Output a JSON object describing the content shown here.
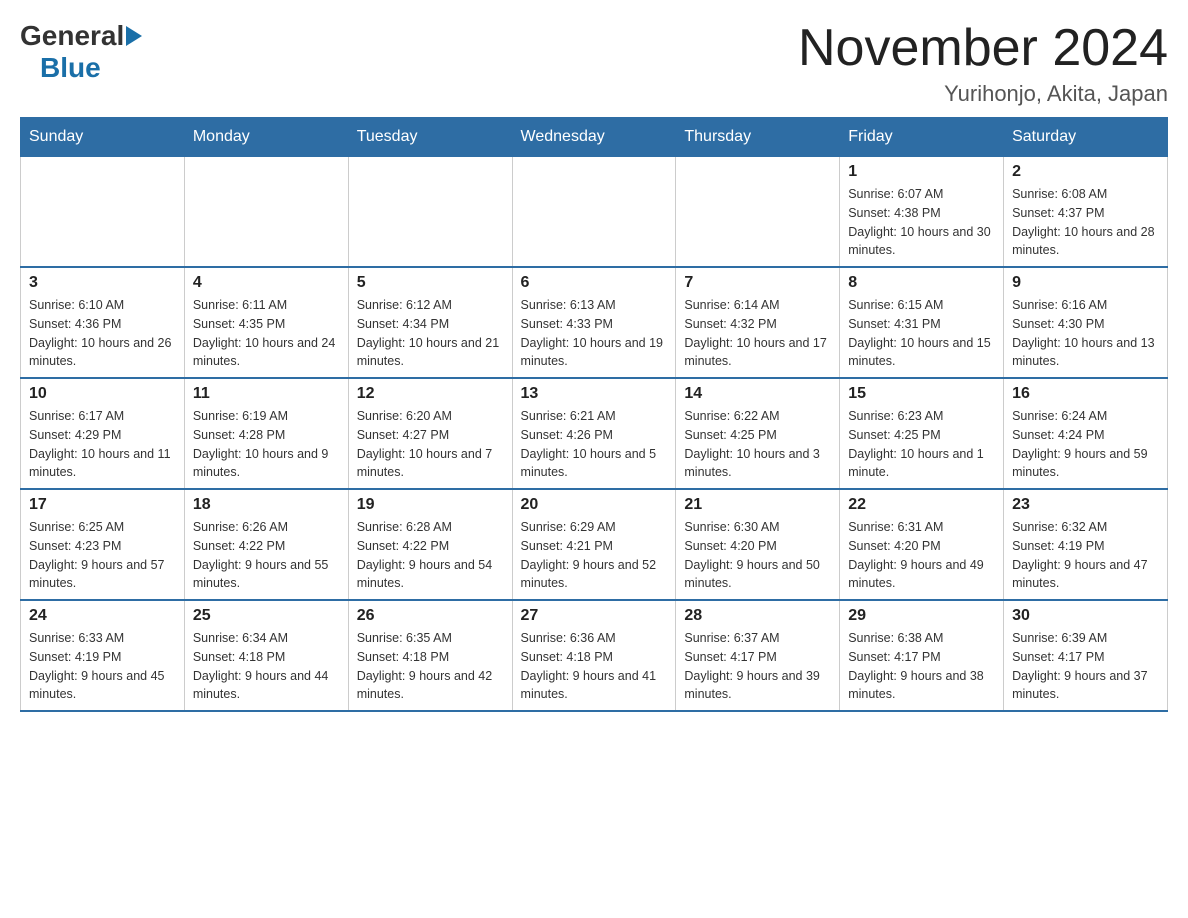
{
  "header": {
    "logo_general": "General",
    "logo_blue": "Blue",
    "title": "November 2024",
    "subtitle": "Yurihonjo, Akita, Japan"
  },
  "weekdays": [
    "Sunday",
    "Monday",
    "Tuesday",
    "Wednesday",
    "Thursday",
    "Friday",
    "Saturday"
  ],
  "weeks": [
    [
      {
        "day": "",
        "sunrise": "",
        "sunset": "",
        "daylight": ""
      },
      {
        "day": "",
        "sunrise": "",
        "sunset": "",
        "daylight": ""
      },
      {
        "day": "",
        "sunrise": "",
        "sunset": "",
        "daylight": ""
      },
      {
        "day": "",
        "sunrise": "",
        "sunset": "",
        "daylight": ""
      },
      {
        "day": "",
        "sunrise": "",
        "sunset": "",
        "daylight": ""
      },
      {
        "day": "1",
        "sunrise": "Sunrise: 6:07 AM",
        "sunset": "Sunset: 4:38 PM",
        "daylight": "Daylight: 10 hours and 30 minutes."
      },
      {
        "day": "2",
        "sunrise": "Sunrise: 6:08 AM",
        "sunset": "Sunset: 4:37 PM",
        "daylight": "Daylight: 10 hours and 28 minutes."
      }
    ],
    [
      {
        "day": "3",
        "sunrise": "Sunrise: 6:10 AM",
        "sunset": "Sunset: 4:36 PM",
        "daylight": "Daylight: 10 hours and 26 minutes."
      },
      {
        "day": "4",
        "sunrise": "Sunrise: 6:11 AM",
        "sunset": "Sunset: 4:35 PM",
        "daylight": "Daylight: 10 hours and 24 minutes."
      },
      {
        "day": "5",
        "sunrise": "Sunrise: 6:12 AM",
        "sunset": "Sunset: 4:34 PM",
        "daylight": "Daylight: 10 hours and 21 minutes."
      },
      {
        "day": "6",
        "sunrise": "Sunrise: 6:13 AM",
        "sunset": "Sunset: 4:33 PM",
        "daylight": "Daylight: 10 hours and 19 minutes."
      },
      {
        "day": "7",
        "sunrise": "Sunrise: 6:14 AM",
        "sunset": "Sunset: 4:32 PM",
        "daylight": "Daylight: 10 hours and 17 minutes."
      },
      {
        "day": "8",
        "sunrise": "Sunrise: 6:15 AM",
        "sunset": "Sunset: 4:31 PM",
        "daylight": "Daylight: 10 hours and 15 minutes."
      },
      {
        "day": "9",
        "sunrise": "Sunrise: 6:16 AM",
        "sunset": "Sunset: 4:30 PM",
        "daylight": "Daylight: 10 hours and 13 minutes."
      }
    ],
    [
      {
        "day": "10",
        "sunrise": "Sunrise: 6:17 AM",
        "sunset": "Sunset: 4:29 PM",
        "daylight": "Daylight: 10 hours and 11 minutes."
      },
      {
        "day": "11",
        "sunrise": "Sunrise: 6:19 AM",
        "sunset": "Sunset: 4:28 PM",
        "daylight": "Daylight: 10 hours and 9 minutes."
      },
      {
        "day": "12",
        "sunrise": "Sunrise: 6:20 AM",
        "sunset": "Sunset: 4:27 PM",
        "daylight": "Daylight: 10 hours and 7 minutes."
      },
      {
        "day": "13",
        "sunrise": "Sunrise: 6:21 AM",
        "sunset": "Sunset: 4:26 PM",
        "daylight": "Daylight: 10 hours and 5 minutes."
      },
      {
        "day": "14",
        "sunrise": "Sunrise: 6:22 AM",
        "sunset": "Sunset: 4:25 PM",
        "daylight": "Daylight: 10 hours and 3 minutes."
      },
      {
        "day": "15",
        "sunrise": "Sunrise: 6:23 AM",
        "sunset": "Sunset: 4:25 PM",
        "daylight": "Daylight: 10 hours and 1 minute."
      },
      {
        "day": "16",
        "sunrise": "Sunrise: 6:24 AM",
        "sunset": "Sunset: 4:24 PM",
        "daylight": "Daylight: 9 hours and 59 minutes."
      }
    ],
    [
      {
        "day": "17",
        "sunrise": "Sunrise: 6:25 AM",
        "sunset": "Sunset: 4:23 PM",
        "daylight": "Daylight: 9 hours and 57 minutes."
      },
      {
        "day": "18",
        "sunrise": "Sunrise: 6:26 AM",
        "sunset": "Sunset: 4:22 PM",
        "daylight": "Daylight: 9 hours and 55 minutes."
      },
      {
        "day": "19",
        "sunrise": "Sunrise: 6:28 AM",
        "sunset": "Sunset: 4:22 PM",
        "daylight": "Daylight: 9 hours and 54 minutes."
      },
      {
        "day": "20",
        "sunrise": "Sunrise: 6:29 AM",
        "sunset": "Sunset: 4:21 PM",
        "daylight": "Daylight: 9 hours and 52 minutes."
      },
      {
        "day": "21",
        "sunrise": "Sunrise: 6:30 AM",
        "sunset": "Sunset: 4:20 PM",
        "daylight": "Daylight: 9 hours and 50 minutes."
      },
      {
        "day": "22",
        "sunrise": "Sunrise: 6:31 AM",
        "sunset": "Sunset: 4:20 PM",
        "daylight": "Daylight: 9 hours and 49 minutes."
      },
      {
        "day": "23",
        "sunrise": "Sunrise: 6:32 AM",
        "sunset": "Sunset: 4:19 PM",
        "daylight": "Daylight: 9 hours and 47 minutes."
      }
    ],
    [
      {
        "day": "24",
        "sunrise": "Sunrise: 6:33 AM",
        "sunset": "Sunset: 4:19 PM",
        "daylight": "Daylight: 9 hours and 45 minutes."
      },
      {
        "day": "25",
        "sunrise": "Sunrise: 6:34 AM",
        "sunset": "Sunset: 4:18 PM",
        "daylight": "Daylight: 9 hours and 44 minutes."
      },
      {
        "day": "26",
        "sunrise": "Sunrise: 6:35 AM",
        "sunset": "Sunset: 4:18 PM",
        "daylight": "Daylight: 9 hours and 42 minutes."
      },
      {
        "day": "27",
        "sunrise": "Sunrise: 6:36 AM",
        "sunset": "Sunset: 4:18 PM",
        "daylight": "Daylight: 9 hours and 41 minutes."
      },
      {
        "day": "28",
        "sunrise": "Sunrise: 6:37 AM",
        "sunset": "Sunset: 4:17 PM",
        "daylight": "Daylight: 9 hours and 39 minutes."
      },
      {
        "day": "29",
        "sunrise": "Sunrise: 6:38 AM",
        "sunset": "Sunset: 4:17 PM",
        "daylight": "Daylight: 9 hours and 38 minutes."
      },
      {
        "day": "30",
        "sunrise": "Sunrise: 6:39 AM",
        "sunset": "Sunset: 4:17 PM",
        "daylight": "Daylight: 9 hours and 37 minutes."
      }
    ]
  ]
}
